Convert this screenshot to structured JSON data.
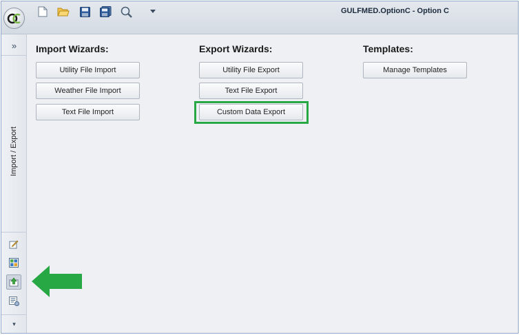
{
  "window": {
    "title": "GULFMED.OptionC - Option C"
  },
  "quick_access": {
    "items": [
      {
        "icon": "new-document-icon"
      },
      {
        "icon": "open-folder-icon"
      },
      {
        "icon": "save-icon"
      },
      {
        "icon": "save-all-icon"
      },
      {
        "icon": "search-icon"
      },
      {
        "icon": "customize-dropdown-icon"
      }
    ]
  },
  "leftnav": {
    "expand_label": "»",
    "section_label": "Import / Export",
    "icons": [
      "edit-icon",
      "layout-icon",
      "import-export-icon",
      "settings-list-icon"
    ],
    "collapse_label": "▾"
  },
  "import_wizards": {
    "title": "Import Wizards:",
    "buttons": [
      "Utility File Import",
      "Weather File Import",
      "Text File Import"
    ]
  },
  "export_wizards": {
    "title": "Export Wizards:",
    "buttons": [
      "Utility File Export",
      "Text File Export",
      "Custom Data Export"
    ]
  },
  "templates": {
    "title": "Templates:",
    "buttons": [
      "Manage Templates"
    ]
  },
  "colors": {
    "highlight": "#27a844",
    "arrow": "#27a844",
    "accent_border": "#8fa8c8"
  }
}
